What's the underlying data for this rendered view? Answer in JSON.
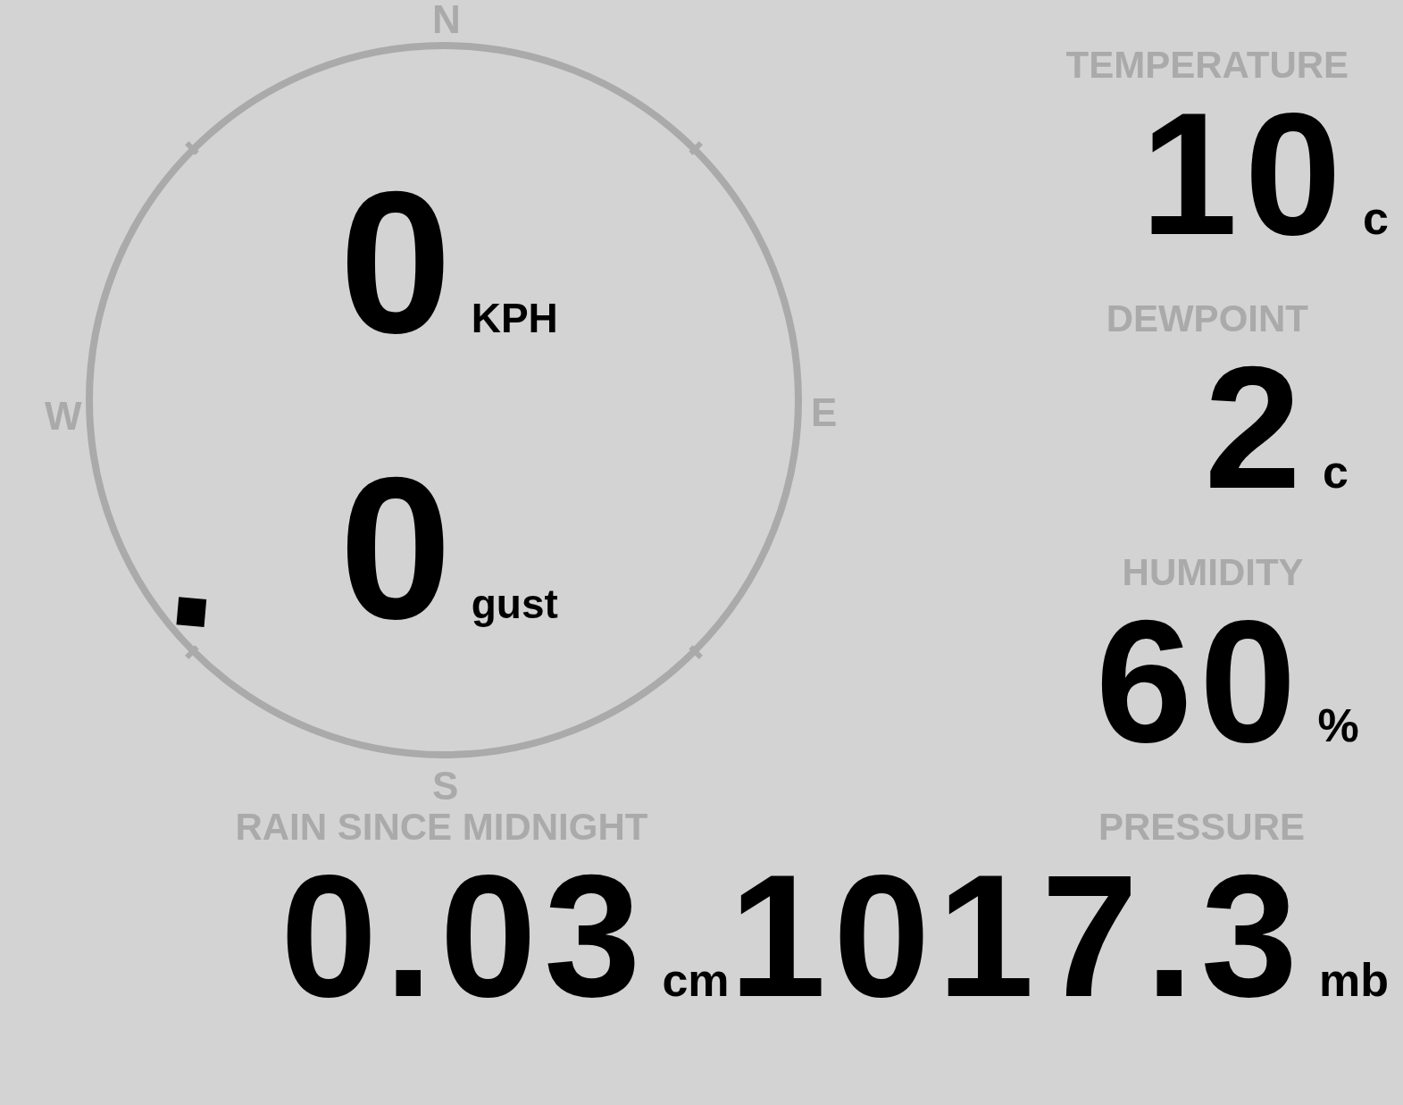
{
  "compass": {
    "north": "N",
    "east": "E",
    "south": "S",
    "west": "W",
    "marker": {
      "kind": "southwest"
    }
  },
  "wind": [
    {
      "value": "0",
      "unit": "KPH"
    },
    {
      "value": "0",
      "unit": "gust"
    }
  ],
  "readings": [
    {
      "label": "TEMPERATURE",
      "value": "10",
      "unit": "c"
    },
    {
      "label": "DEWPOINT",
      "value": "2",
      "unit": "c"
    },
    {
      "label": "HUMIDITY",
      "value": "60",
      "unit": "%"
    }
  ],
  "rain": {
    "label": "RAIN SINCE MIDNIGHT",
    "value": "0.03",
    "unit": "cm"
  },
  "pressure": {
    "label": "PRESSURE",
    "value": "1017.3",
    "unit": "mb"
  }
}
